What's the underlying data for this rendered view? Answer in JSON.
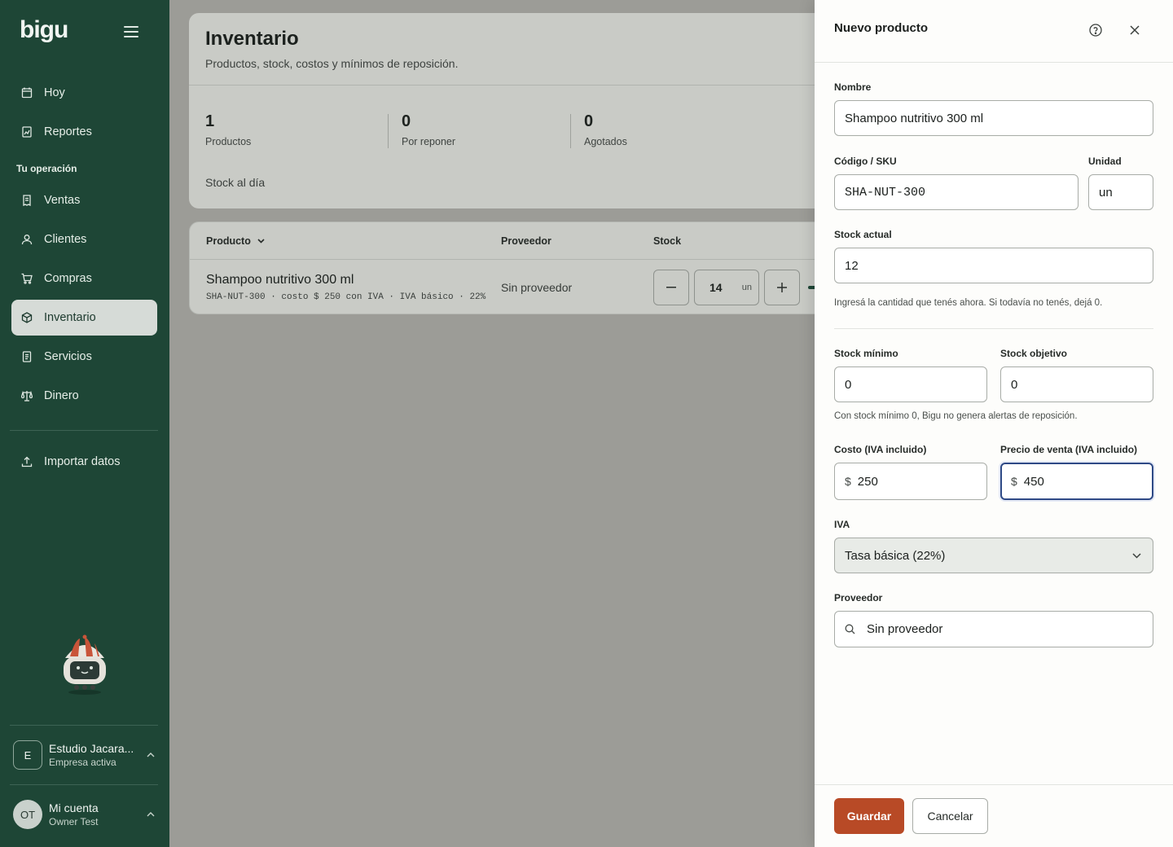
{
  "sidebar": {
    "logo": "bigu",
    "nav": [
      {
        "label": "Hoy",
        "icon": "calendar-icon"
      },
      {
        "label": "Reportes",
        "icon": "report-icon"
      },
      {
        "label": "Ventas",
        "icon": "receipt-icon"
      },
      {
        "label": "Clientes",
        "icon": "user-icon"
      },
      {
        "label": "Compras",
        "icon": "cart-icon"
      },
      {
        "label": "Inventario",
        "icon": "box-icon",
        "active": true
      },
      {
        "label": "Servicios",
        "icon": "document-icon"
      },
      {
        "label": "Dinero",
        "icon": "scale-icon"
      },
      {
        "label": "Importar datos",
        "icon": "upload-icon"
      }
    ],
    "section_label": "Tu operación",
    "company": {
      "initial": "E",
      "name": "Estudio Jacara...",
      "subtitle": "Empresa activa"
    },
    "account": {
      "initials": "OT",
      "name": "Mi cuenta",
      "subtitle": "Owner Test"
    }
  },
  "main": {
    "title": "Inventario",
    "subtitle": "Productos, stock, costos y mínimos de reposición.",
    "stats": [
      {
        "value": "1",
        "label": "Productos"
      },
      {
        "value": "0",
        "label": "Por reponer"
      },
      {
        "value": "0",
        "label": "Agotados"
      }
    ],
    "stock_note": "Stock al día",
    "table": {
      "headers": {
        "product": "Producto",
        "supplier": "Proveedor",
        "stock": "Stock"
      },
      "rows": [
        {
          "name": "Shampoo nutritivo 300 ml",
          "meta": "SHA-NUT-300 · costo $ 250 con IVA · IVA básico · 22%",
          "supplier": "Sin proveedor",
          "stock": "14",
          "unit": "un"
        }
      ]
    }
  },
  "drawer": {
    "title": "Nuevo producto",
    "fields": {
      "name": {
        "label": "Nombre",
        "value": "Shampoo nutritivo 300 ml"
      },
      "sku": {
        "label": "Código / SKU",
        "value": "SHA-NUT-300"
      },
      "unit": {
        "label": "Unidad",
        "value": "un"
      },
      "stock": {
        "label": "Stock actual",
        "value": "12",
        "help": "Ingresá la cantidad que tenés ahora. Si todavía no tenés, dejá 0."
      },
      "min": {
        "label": "Stock mínimo",
        "value": "0"
      },
      "target": {
        "label": "Stock objetivo",
        "value": "0"
      },
      "min_help": "Con stock mínimo 0, Bigu no genera alertas de reposición.",
      "cost": {
        "label": "Costo (IVA incluido)",
        "prefix": "$",
        "value": "250"
      },
      "price": {
        "label": "Precio de venta (IVA incluido)",
        "prefix": "$",
        "value": "450"
      },
      "iva": {
        "label": "IVA",
        "value": "Tasa básica (22%)"
      },
      "supplier": {
        "label": "Proveedor",
        "value": "Sin proveedor"
      }
    },
    "save_label": "Guardar",
    "cancel_label": "Cancelar"
  }
}
